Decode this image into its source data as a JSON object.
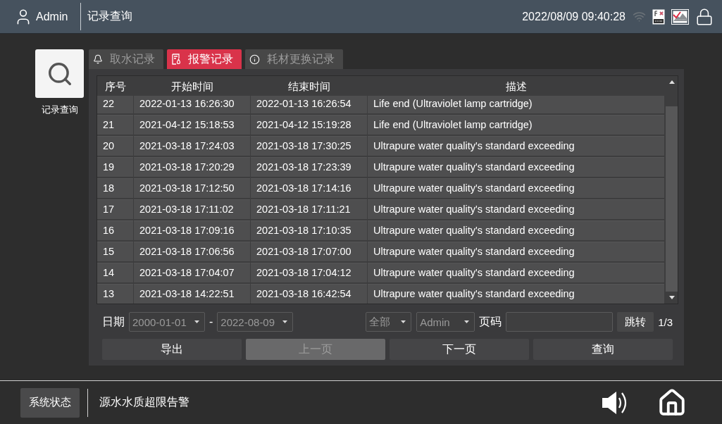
{
  "header": {
    "user": "Admin",
    "title": "记录查询",
    "datetime": "2022/08/09 09:40:28"
  },
  "nav_button": {
    "label": "记录查询"
  },
  "tabs": [
    {
      "label": "取水记录",
      "selected": false
    },
    {
      "label": "报警记录",
      "selected": true
    },
    {
      "label": "耗材更换记录",
      "selected": false
    }
  ],
  "table": {
    "columns": [
      "序号",
      "开始时间",
      "结束时间",
      "描述"
    ],
    "rows": [
      [
        "22",
        "2022-01-13 16:26:30",
        "2022-01-13 16:26:54",
        "Life end (Ultraviolet lamp cartridge)"
      ],
      [
        "21",
        "2021-04-12 15:18:53",
        "2021-04-12 15:19:28",
        "Life end (Ultraviolet lamp cartridge)"
      ],
      [
        "20",
        "2021-03-18 17:24:03",
        "2021-03-18 17:30:25",
        "Ultrapure water quality's standard exceeding"
      ],
      [
        "19",
        "2021-03-18 17:20:29",
        "2021-03-18 17:23:39",
        "Ultrapure water quality's standard exceeding"
      ],
      [
        "18",
        "2021-03-18 17:12:50",
        "2021-03-18 17:14:16",
        "Ultrapure water quality's standard exceeding"
      ],
      [
        "17",
        "2021-03-18 17:11:02",
        "2021-03-18 17:11:21",
        "Ultrapure water quality's standard exceeding"
      ],
      [
        "16",
        "2021-03-18 17:09:16",
        "2021-03-18 17:10:35",
        "Ultrapure water quality's standard exceeding"
      ],
      [
        "15",
        "2021-03-18 17:06:56",
        "2021-03-18 17:07:00",
        "Ultrapure water quality's standard exceeding"
      ],
      [
        "14",
        "2021-03-18 17:04:07",
        "2021-03-18 17:04:12",
        "Ultrapure water quality's standard exceeding"
      ],
      [
        "13",
        "2021-03-18 14:22:51",
        "2021-03-18 16:42:54",
        "Ultrapure water quality's standard exceeding"
      ]
    ]
  },
  "filters": {
    "date_label": "日期",
    "date_from": "2000-01-01",
    "separator": "-",
    "date_to": "2022-08-09",
    "type": "全部",
    "user": "Admin",
    "page_label": "页码",
    "jump_button": "跳转",
    "page_count": "1/3"
  },
  "buttons": [
    {
      "label": "导出",
      "disabled": false
    },
    {
      "label": "上一页",
      "disabled": true
    },
    {
      "label": "下一页",
      "disabled": false
    },
    {
      "label": "查询",
      "disabled": false
    }
  ],
  "status_bar": {
    "button": "系统状态",
    "message": "源水水质超限告警"
  }
}
